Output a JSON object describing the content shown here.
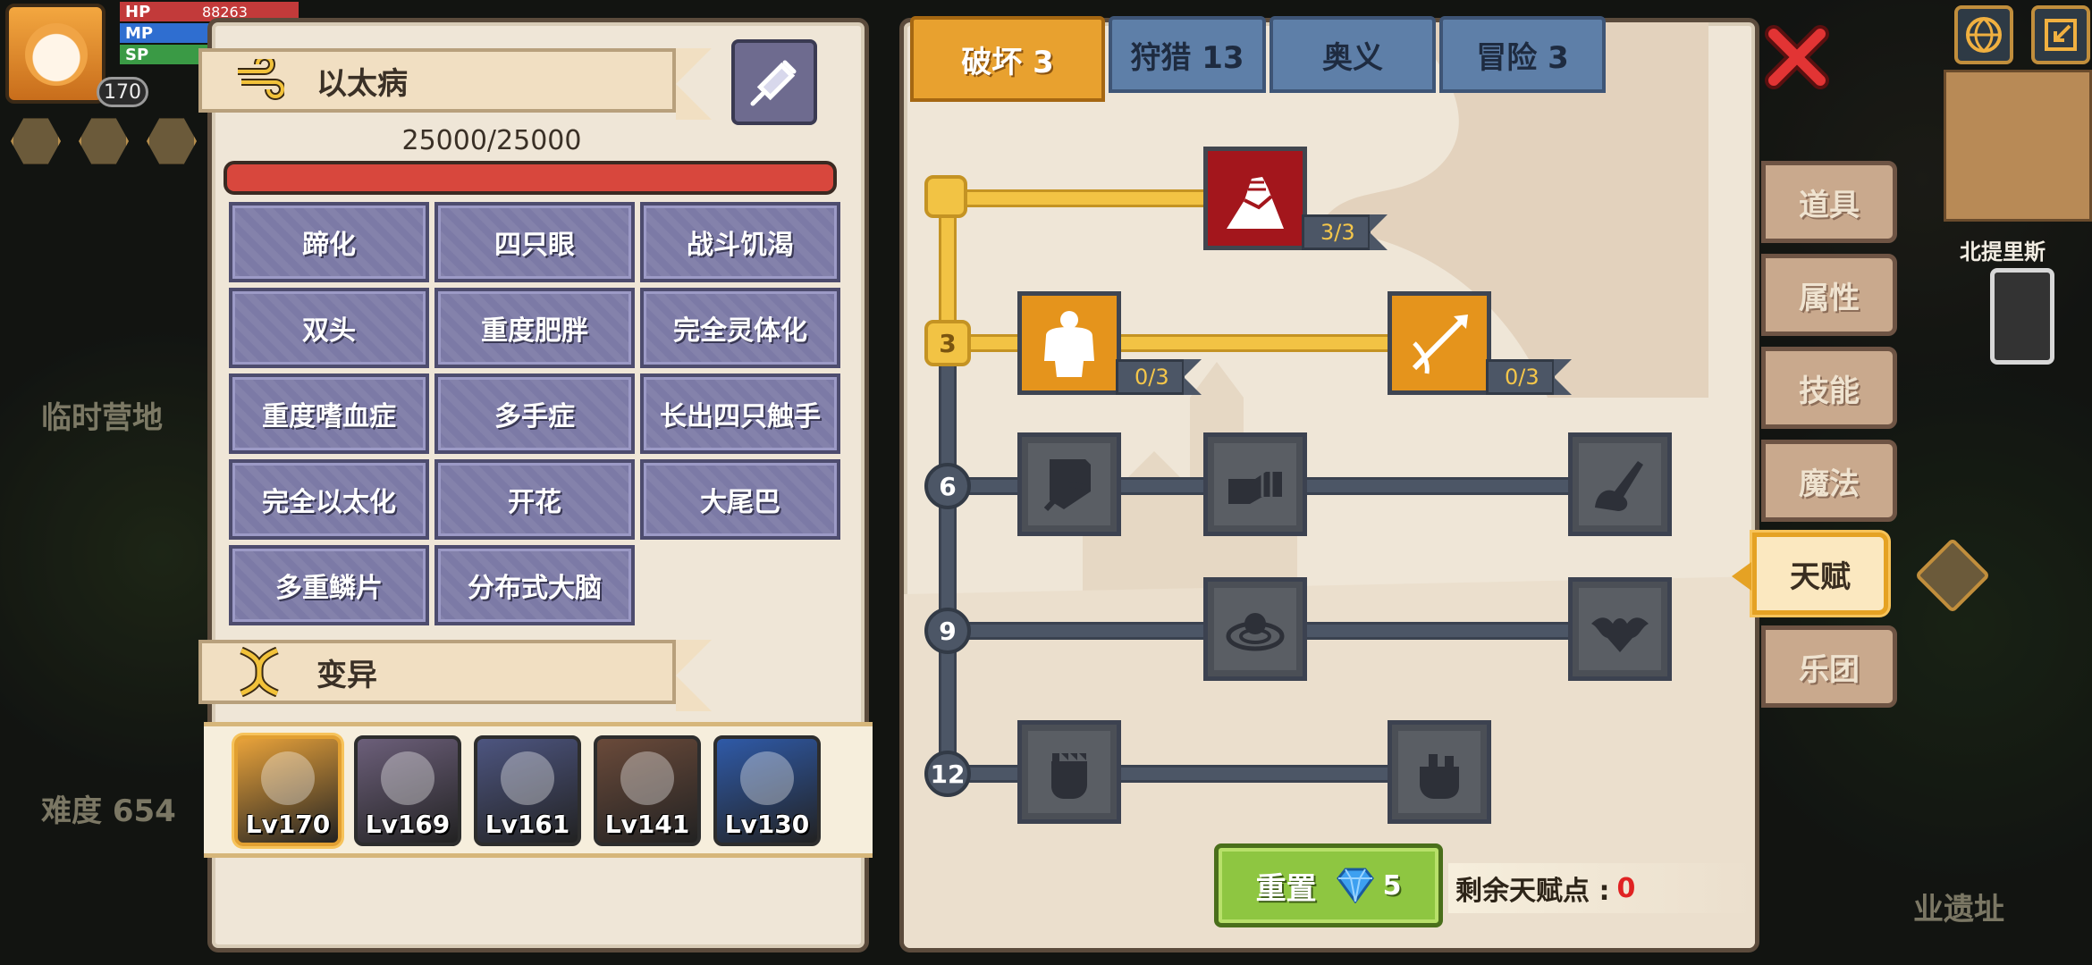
{
  "hud": {
    "stats": [
      {
        "label": "HP",
        "value": "88263"
      },
      {
        "label": "MP",
        "value": ""
      },
      {
        "label": "SP",
        "value": ""
      }
    ],
    "level": "170",
    "world_labels": {
      "temp_base": "临时营地",
      "difficulty": "难度 654",
      "north": "北提里斯",
      "ruins": "业遗址"
    }
  },
  "left_panel": {
    "ether_title": "以太病",
    "hp_text": "25000/25000",
    "hp_fraction": 1.0,
    "traits": [
      "蹄化",
      "四只眼",
      "战斗饥渴",
      "双头",
      "重度肥胖",
      "完全灵体化",
      "重度嗜血症",
      "多手症",
      "长出四只触手",
      "完全以太化",
      "开花",
      "大尾巴",
      "多重鳞片",
      "分布式大脑"
    ],
    "mutation_title": "变异",
    "characters": [
      {
        "level": "Lv170",
        "selected": true,
        "color": "#e8a23a"
      },
      {
        "level": "Lv169",
        "selected": false,
        "color": "#6c5f7a"
      },
      {
        "level": "Lv161",
        "selected": false,
        "color": "#4d5580"
      },
      {
        "level": "Lv141",
        "selected": false,
        "color": "#6a4a3a"
      },
      {
        "level": "Lv130",
        "selected": false,
        "color": "#2f5aa8"
      }
    ]
  },
  "right_panel": {
    "tabs": [
      {
        "label": "破坏 3",
        "active": true
      },
      {
        "label": "狩猎 13",
        "active": false
      },
      {
        "label": "奥义",
        "active": false
      },
      {
        "label": "冒险 3",
        "active": false
      }
    ],
    "tier_labels": [
      "",
      "3",
      "6",
      "9",
      "12"
    ],
    "skills": {
      "armwrestle": {
        "progress": "3/3"
      },
      "body": {
        "progress": "0/3"
      },
      "arrow": {
        "progress": "0/3"
      }
    },
    "reset_label": "重置",
    "reset_cost": "5",
    "remaining_label": "剩余天赋点 :",
    "remaining_value": "0"
  },
  "side_tabs": [
    {
      "label": "道具",
      "active": false
    },
    {
      "label": "属性",
      "active": false
    },
    {
      "label": "技能",
      "active": false
    },
    {
      "label": "魔法",
      "active": false
    },
    {
      "label": "天赋",
      "active": true
    },
    {
      "label": "乐团",
      "active": false
    }
  ],
  "colors": {
    "panel_bg": "#efe6d7",
    "trait_bg": "#7c7aa6",
    "active_tab": "#e8a12f",
    "inactive_tab": "#5e7fa8",
    "gold_path": "#f2c344",
    "reset_green": "#8ec641"
  }
}
